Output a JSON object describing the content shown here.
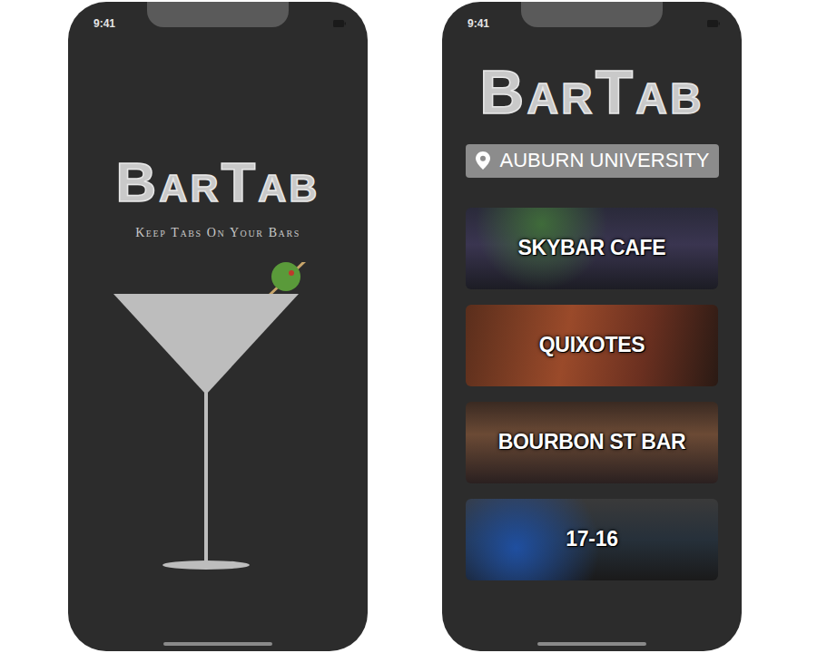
{
  "splash": {
    "status_time": "9:41",
    "logo": "BarTab",
    "tagline": "Keep Tabs On Your Bars"
  },
  "home": {
    "status_time": "9:41",
    "logo": "BarTab",
    "location": "AUBURN UNIVERSITY",
    "bars": [
      {
        "name": "SKYBAR CAFE"
      },
      {
        "name": "QUIXOTES"
      },
      {
        "name": "BOURBON ST BAR"
      },
      {
        "name": "17-16"
      }
    ]
  }
}
